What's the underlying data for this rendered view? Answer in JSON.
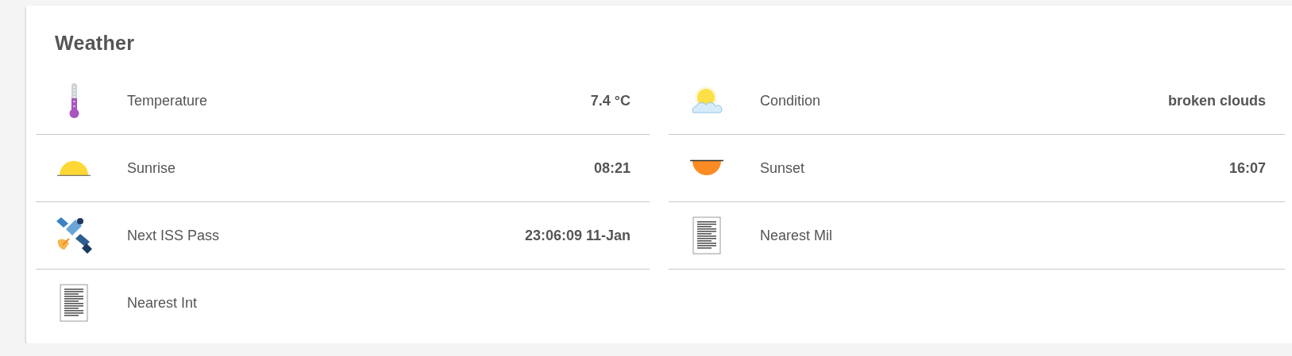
{
  "card": {
    "title": "Weather",
    "items": [
      {
        "kind": "thermometer",
        "label": "Temperature",
        "value": "7.4 °C"
      },
      {
        "kind": "sun-cloud",
        "label": "Condition",
        "value": "broken clouds"
      },
      {
        "kind": "sunrise",
        "label": "Sunrise",
        "value": "08:21"
      },
      {
        "kind": "sunset",
        "label": "Sunset",
        "value": "16:07"
      },
      {
        "kind": "satellite",
        "label": "Next ISS Pass",
        "value": "23:06:09 11-Jan"
      },
      {
        "kind": "document",
        "label": "Nearest Mil"
      },
      {
        "kind": "document",
        "label": "Nearest Int"
      }
    ]
  }
}
